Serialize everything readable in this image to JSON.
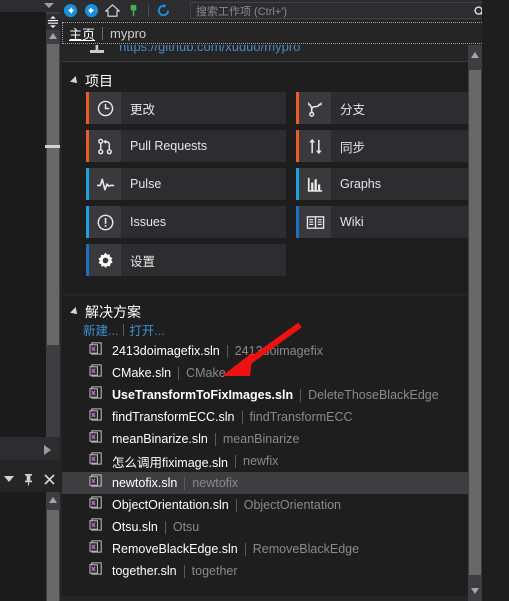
{
  "toolbar": {
    "back_icon": "back-arrow-icon",
    "forward_icon": "forward-arrow-icon",
    "home_icon": "home-icon",
    "connect_icon": "connect-plug-icon",
    "refresh_icon": "refresh-icon",
    "search_placeholder": "搜索工作项 (Ctrl+')",
    "search_icon": "search-icon"
  },
  "breadcrumb": {
    "home_label": "主页",
    "current_label": "mypro",
    "dropdown_icon": "chevron-down-icon"
  },
  "repo": {
    "url": "https://github.com/xuduo/mypro",
    "icon": "git-repo-icon"
  },
  "project_section": {
    "title": "项目",
    "expander_icon": "triangle-expanded-icon",
    "tiles": [
      {
        "label": "更改",
        "icon": "clock-history-icon",
        "accent": "#f05a28"
      },
      {
        "label": "分支",
        "icon": "branch-fork-icon",
        "accent": "#f05a28"
      },
      {
        "label": "Pull Requests",
        "icon": "pull-request-icon",
        "accent": "#f05a28"
      },
      {
        "label": "同步",
        "icon": "sync-arrows-icon",
        "accent": "#f05a28"
      },
      {
        "label": "Pulse",
        "icon": "pulse-wave-icon",
        "accent": "#1ba1e2"
      },
      {
        "label": "Graphs",
        "icon": "bar-chart-icon",
        "accent": "#1ba1e2"
      },
      {
        "label": "Issues",
        "icon": "exclamation-circle-icon",
        "accent": "#1ba1e2"
      },
      {
        "label": "Wiki",
        "icon": "open-book-icon",
        "accent": "#1b6fc4"
      },
      {
        "label": "设置",
        "icon": "gear-icon",
        "accent": "#1b6fc4"
      }
    ]
  },
  "solution_section": {
    "title": "解决方案",
    "expander_icon": "triangle-expanded-icon",
    "new_link": "新建...",
    "open_link": "打开...",
    "solutions": [
      {
        "name": "2413doimagefix.sln",
        "path": "2413doimagefix",
        "bold": false,
        "hover": false
      },
      {
        "name": "CMake.sln",
        "path": "CMake",
        "bold": false,
        "hover": false
      },
      {
        "name": "UseTransformToFixImages.sln",
        "path": "DeleteThoseBlackEdge",
        "bold": true,
        "hover": false
      },
      {
        "name": "findTransformECC.sln",
        "path": "findTransformECC",
        "bold": false,
        "hover": false
      },
      {
        "name": "meanBinarize.sln",
        "path": "meanBinarize",
        "bold": false,
        "hover": false
      },
      {
        "name": "怎么调用fiximage.sln",
        "path": "newfix",
        "bold": false,
        "hover": false
      },
      {
        "name": "newtofix.sln",
        "path": "newtofix",
        "bold": false,
        "hover": true
      },
      {
        "name": "ObjectOrientation.sln",
        "path": "ObjectOrientation",
        "bold": false,
        "hover": false
      },
      {
        "name": "Otsu.sln",
        "path": "Otsu",
        "bold": false,
        "hover": false
      },
      {
        "name": "RemoveBlackEdge.sln",
        "path": "RemoveBlackEdge",
        "bold": false,
        "hover": false
      },
      {
        "name": "together.sln",
        "path": "together",
        "bold": false,
        "hover": false
      }
    ],
    "solution_icon": "visual-studio-solution-icon"
  },
  "left_panel": {
    "collapse_icon": "chevron-down-icon",
    "pin_icon": "pin-icon",
    "close_icon": "close-icon",
    "expand_icon": "triangle-right-icon",
    "scrollbar_up_icon": "scroll-up-arrow-icon",
    "resize_grip_icon": "resize-vertical-icon"
  },
  "scrollbars": {
    "main_up_icon": "scroll-up-arrow-icon",
    "main_down_icon": "scroll-down-arrow-icon",
    "thumb_name": "scroll-thumb"
  },
  "annotation": {
    "arrow_color": "#ee1111",
    "arrow_name": "red-pointer-arrow"
  }
}
